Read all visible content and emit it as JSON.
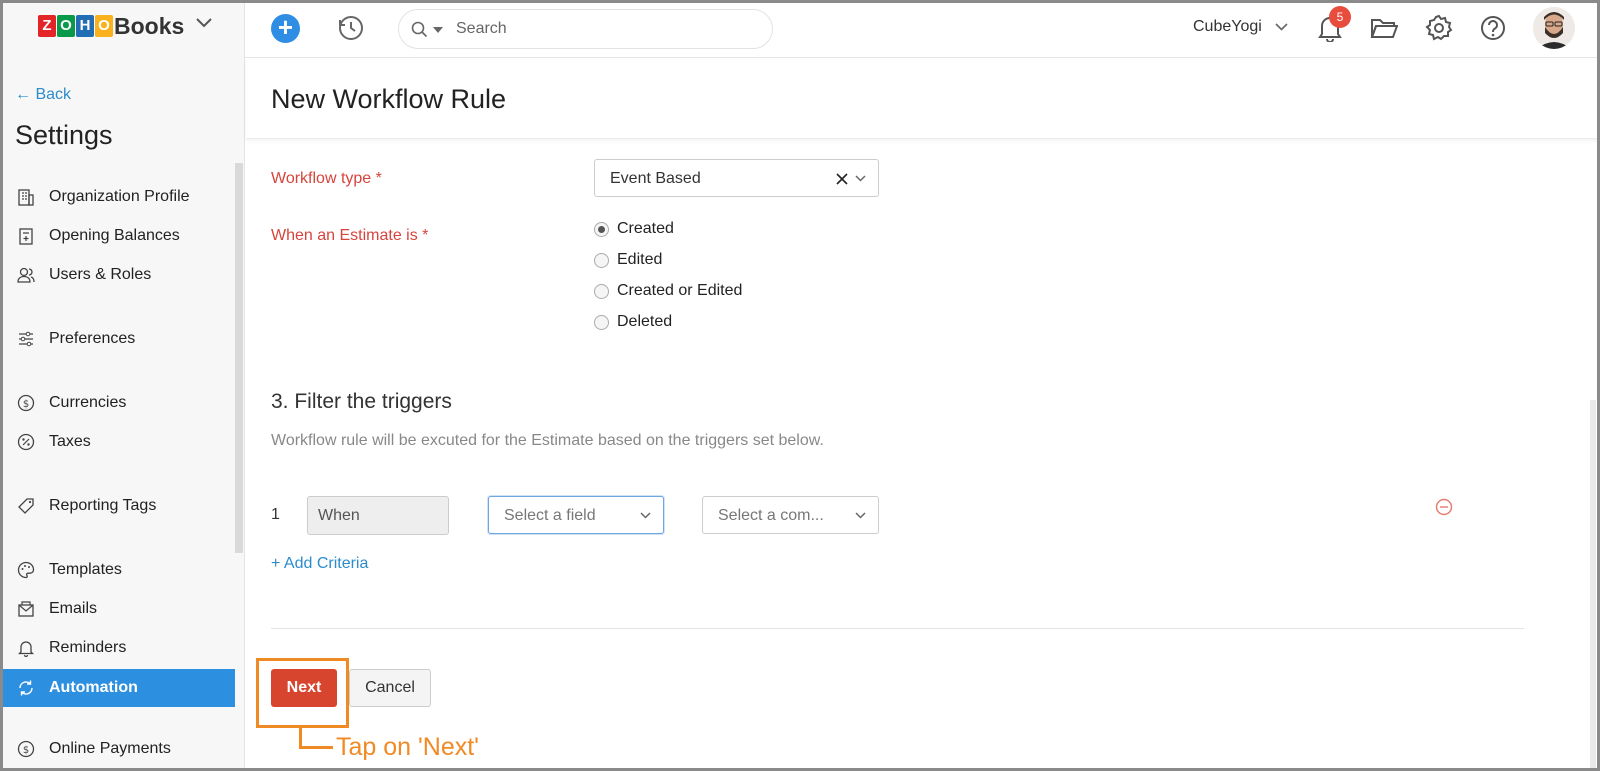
{
  "topbar": {
    "logo_letters": [
      "Z",
      "O",
      "H",
      "O"
    ],
    "logo_colors": [
      "#e42527",
      "#089949",
      "#226db4",
      "#f9b21d"
    ],
    "app_name": "Books",
    "search_placeholder": "Search",
    "org_name": "CubeYogi",
    "notification_count": "5",
    "icons": [
      "plus-icon",
      "history-icon",
      "search-icon",
      "bell-icon",
      "folder-icon",
      "gear-icon",
      "help-icon"
    ]
  },
  "sidebar": {
    "back_label": "Back",
    "title": "Settings",
    "items": [
      {
        "label": "Organization Profile",
        "icon": "building-icon"
      },
      {
        "label": "Opening Balances",
        "icon": "ledger-icon"
      },
      {
        "label": "Users & Roles",
        "icon": "users-icon"
      },
      {
        "label": "Preferences",
        "icon": "sliders-icon"
      },
      {
        "label": "Currencies",
        "icon": "currency-icon"
      },
      {
        "label": "Taxes",
        "icon": "percent-icon"
      },
      {
        "label": "Reporting Tags",
        "icon": "tag-icon"
      },
      {
        "label": "Templates",
        "icon": "palette-icon"
      },
      {
        "label": "Emails",
        "icon": "email-icon"
      },
      {
        "label": "Reminders",
        "icon": "bell-icon"
      },
      {
        "label": "Automation",
        "icon": "sync-icon",
        "active": true
      },
      {
        "label": "Online Payments",
        "icon": "payment-icon"
      }
    ]
  },
  "main": {
    "title": "New Workflow Rule",
    "workflow_type_label": "Workflow type *",
    "workflow_type_value": "Event Based",
    "when_label": "When an Estimate is *",
    "when_options": [
      {
        "label": "Created",
        "checked": true
      },
      {
        "label": "Edited",
        "checked": false
      },
      {
        "label": "Created or Edited",
        "checked": false
      },
      {
        "label": "Deleted",
        "checked": false
      }
    ],
    "filter_title": "3. Filter the triggers",
    "filter_desc": "Workflow rule will be excuted for the Estimate based on the triggers set below.",
    "criteria": {
      "row_number": "1",
      "when_label": "When",
      "field_placeholder": "Select a field",
      "comparator_placeholder": "Select a com..."
    },
    "add_criteria_label": "+ Add Criteria",
    "next_label": "Next",
    "cancel_label": "Cancel"
  },
  "annotation": {
    "text": "Tap on 'Next'",
    "color": "#f08a24"
  }
}
